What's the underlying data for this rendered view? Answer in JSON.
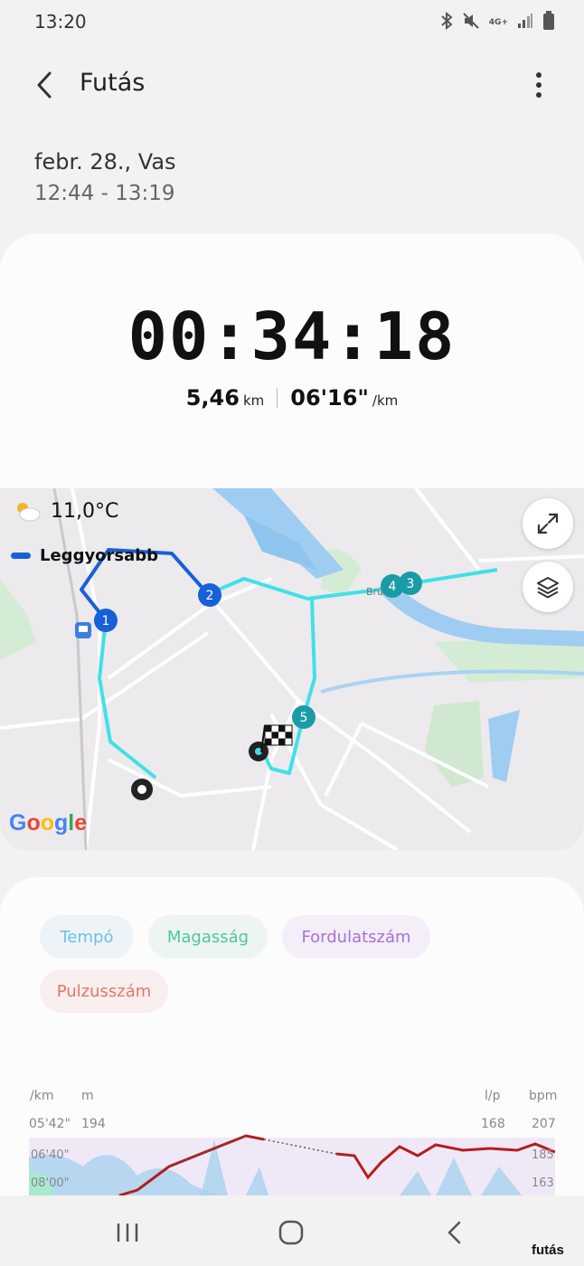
{
  "status_bar": {
    "time": "13:20",
    "icons": [
      "bluetooth-icon",
      "mute-icon",
      "4g-icon",
      "signal-icon",
      "battery-icon"
    ],
    "network": "4G+"
  },
  "header": {
    "title": "Futás",
    "back_icon": "chevron-left-icon",
    "menu_icon": "more-vert-icon"
  },
  "session": {
    "date": "febr. 28., Vas",
    "time_range": "12:44 - 13:19",
    "duration": "00:34:18",
    "distance": "5,46",
    "distance_unit": "km",
    "pace": "06'16\"",
    "pace_unit": "/km"
  },
  "map": {
    "temperature": "11,0°C",
    "weather_icon": "partly-sunny-icon",
    "legend_label": "Leggyorsabb",
    "markers": [
      "1",
      "2",
      "3",
      "4",
      "5"
    ],
    "road_label": "Brü",
    "attribution": "Google",
    "expand_icon": "expand-icon",
    "layers_icon": "layers-icon"
  },
  "chips": [
    {
      "label": "Tempó"
    },
    {
      "label": "Magasság"
    },
    {
      "label": "Fordulatszám"
    },
    {
      "label": "Pulzusszám"
    }
  ],
  "chart": {
    "units": {
      "pace": "/km",
      "altitude": "m",
      "cadence": "l/p",
      "hr": "bpm"
    },
    "left_pace_ticks": [
      "05'42\"",
      "06'40\"",
      "08'00\""
    ],
    "altitude_ticks": [
      "194"
    ],
    "cadence_ticks": [
      "168"
    ],
    "hr_ticks": [
      "207",
      "185",
      "163"
    ],
    "colors": {
      "pace": "#9cc8e8",
      "altitude": "#8fe0bf",
      "cadence": "#c9b6ea",
      "hr": "#b71c1c"
    }
  },
  "navbar": {
    "recent_icon": "recent-apps-icon",
    "home_icon": "home-icon",
    "back_icon": "back-icon"
  },
  "watermark": "futás"
}
